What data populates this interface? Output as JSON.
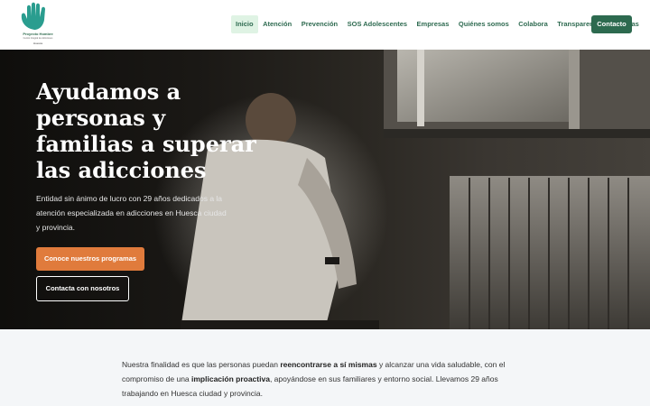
{
  "logo": {
    "name": "Proyecto Hombre",
    "subtitle": "Centro Integral de Adicciones",
    "city": "Huesca"
  },
  "nav": {
    "items": [
      {
        "label": "Inicio",
        "active": true
      },
      {
        "label": "Atención",
        "active": false
      },
      {
        "label": "Prevención",
        "active": false
      },
      {
        "label": "SOS Adolescentes",
        "active": false
      },
      {
        "label": "Empresas",
        "active": false
      },
      {
        "label": "Quiénes somos",
        "active": false
      },
      {
        "label": "Colabora",
        "active": false
      },
      {
        "label": "Transparencia",
        "active": false
      },
      {
        "label": "Noticias",
        "active": false
      }
    ],
    "contact_label": "Contacto"
  },
  "hero": {
    "title_lines": [
      "Ayudamos a",
      "personas y",
      "familias a superar",
      "las adicciones"
    ],
    "description": "Entidad sin ánimo de lucro con 29 años dedicados a la atención especializada en adicciones en Huesca ciudad y provincia.",
    "primary_button": "Conoce nuestros programas",
    "secondary_button": "Contacta con nosotros"
  },
  "intro": {
    "part1": "Nuestra finalidad es que las personas puedan ",
    "bold1": "reencontrarse a sí mismas",
    "part2": " y alcanzar una vida saludable, con el compromiso de una ",
    "bold2": "implicación proactiva",
    "part3": ", apoyándose en sus familiares y entorno social. Llevamos 29 años trabajando en Huesca ciudad y provincia."
  },
  "colors": {
    "brand_green": "#2d6a4f",
    "accent_orange": "#e07b3c",
    "logo_teal": "#2a9d8f",
    "nav_active_bg": "#dff3e4"
  }
}
